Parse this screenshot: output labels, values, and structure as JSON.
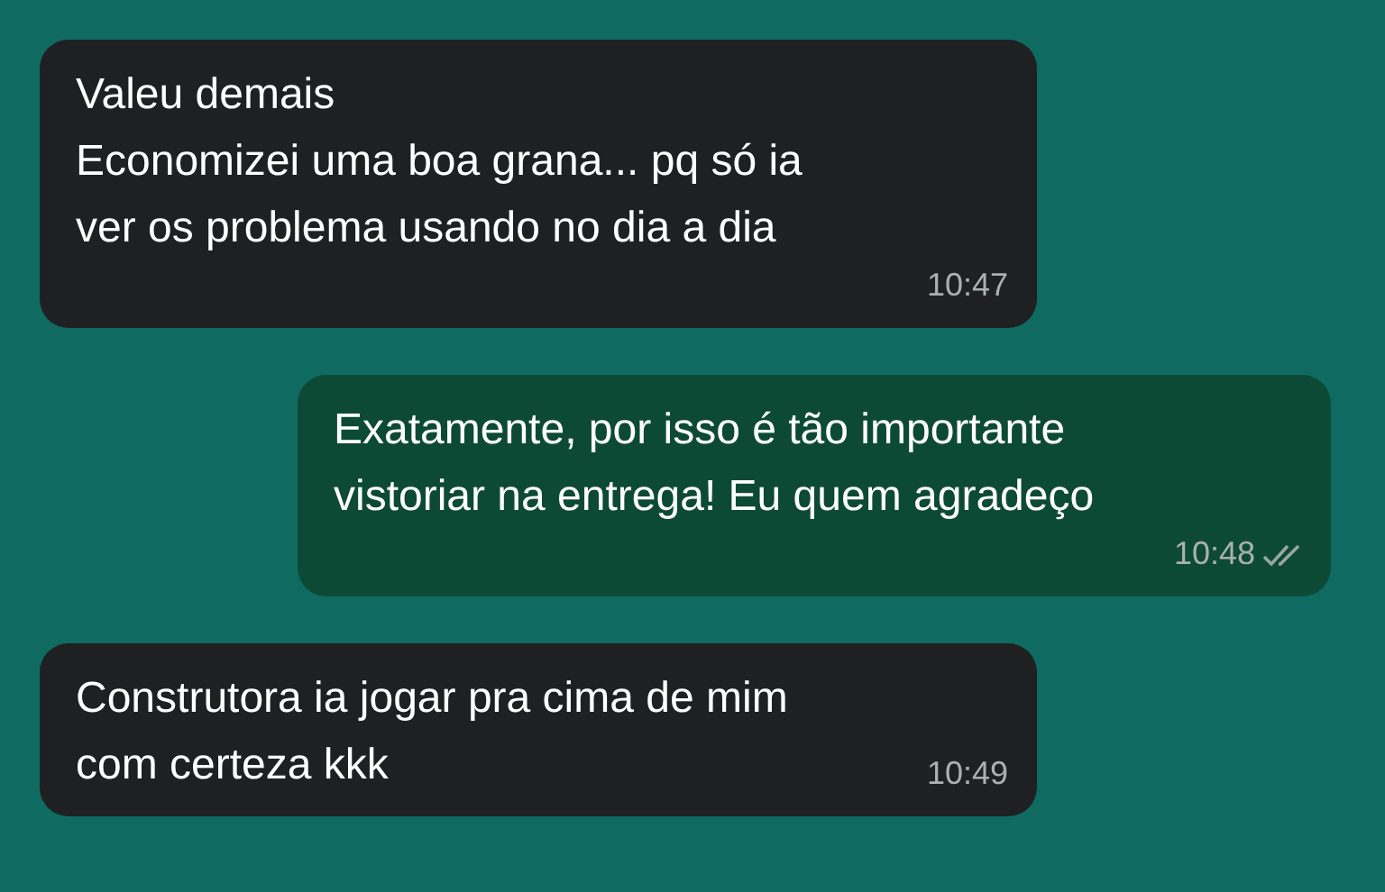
{
  "messages": [
    {
      "kind": "incoming",
      "text": "Valeu demais\nEconomizei uma boa grana... pq só ia\nver os problema usando no dia a dia",
      "time": "10:47"
    },
    {
      "kind": "outgoing",
      "text": "Exatamente, por isso é tão importante\nvistoriar na entrega! Eu quem agradeço",
      "time": "10:48",
      "read": false
    },
    {
      "kind": "incoming",
      "text": "Construtora ia jogar pra cima de mim\ncom certeza kkk",
      "time": "10:49"
    }
  ]
}
